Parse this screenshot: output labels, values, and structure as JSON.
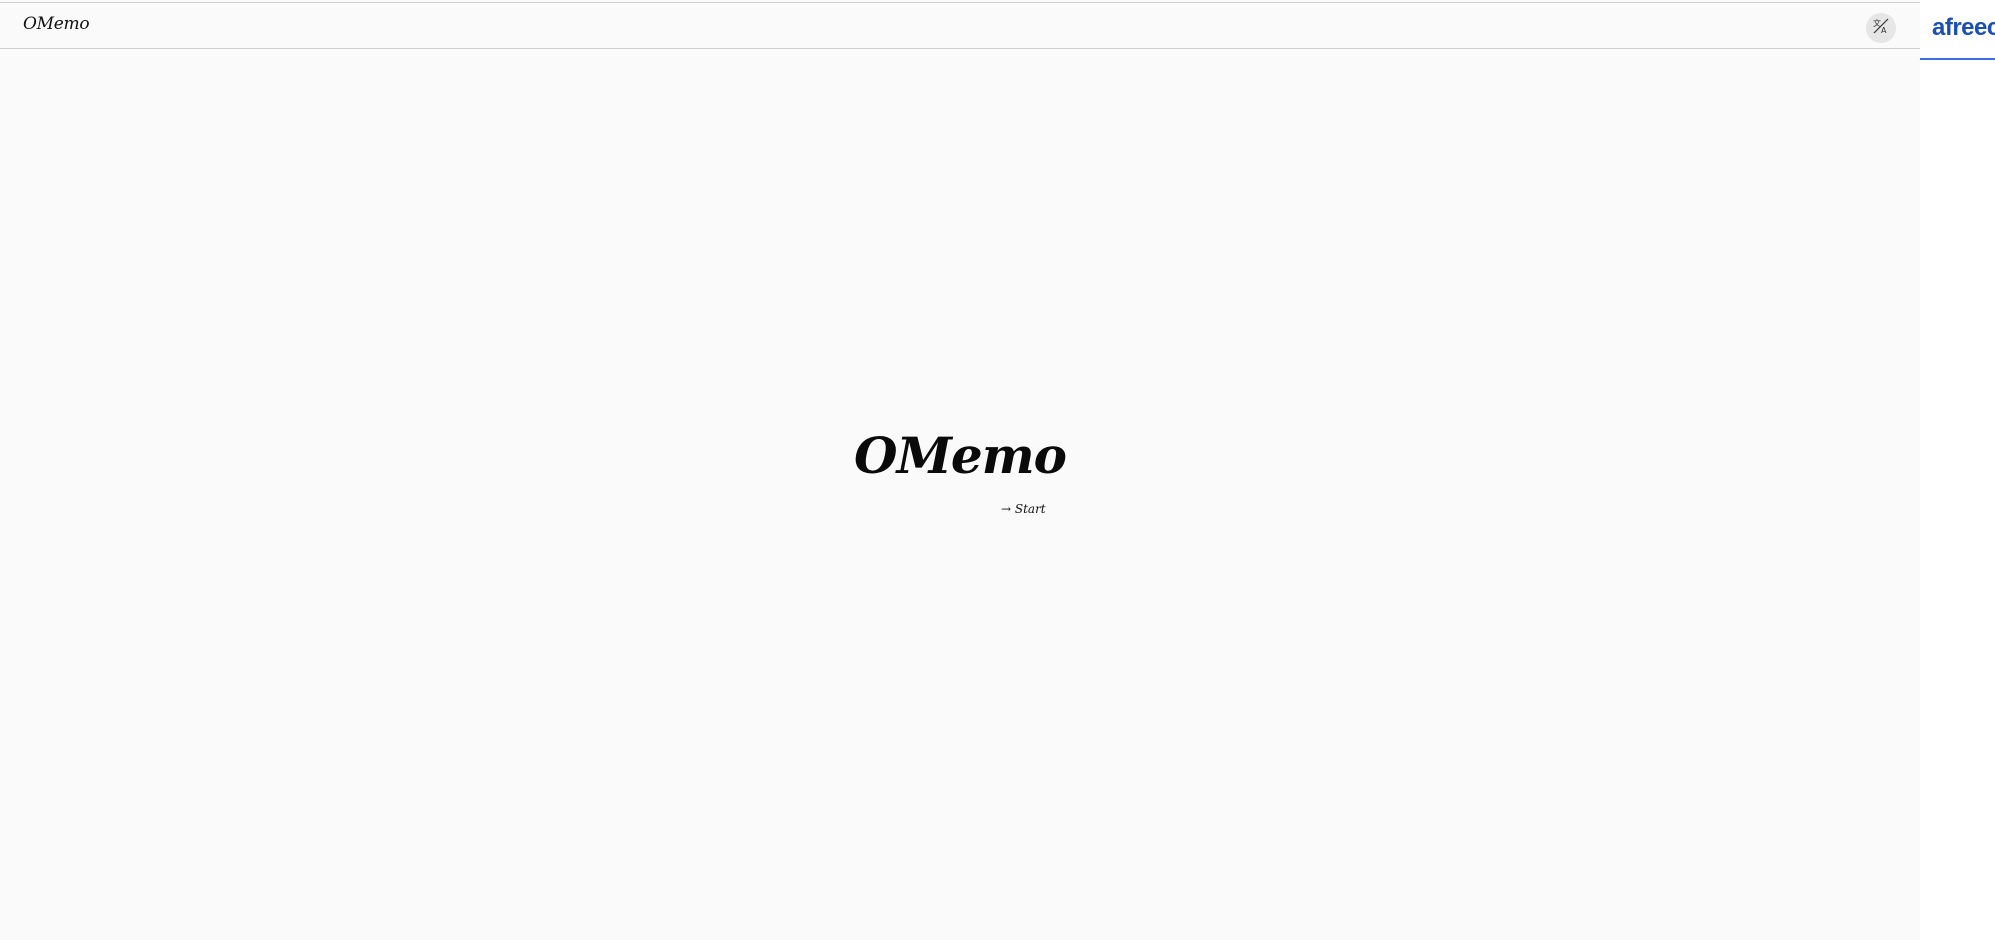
{
  "header": {
    "brand": "OMemo",
    "toggle_icon": "translate-toggle-icon"
  },
  "hero": {
    "title": "OMemo",
    "start_link": "→ Start"
  },
  "side_panel": {
    "logo_text": "afreec",
    "accent_color": "#1a4fb4"
  }
}
